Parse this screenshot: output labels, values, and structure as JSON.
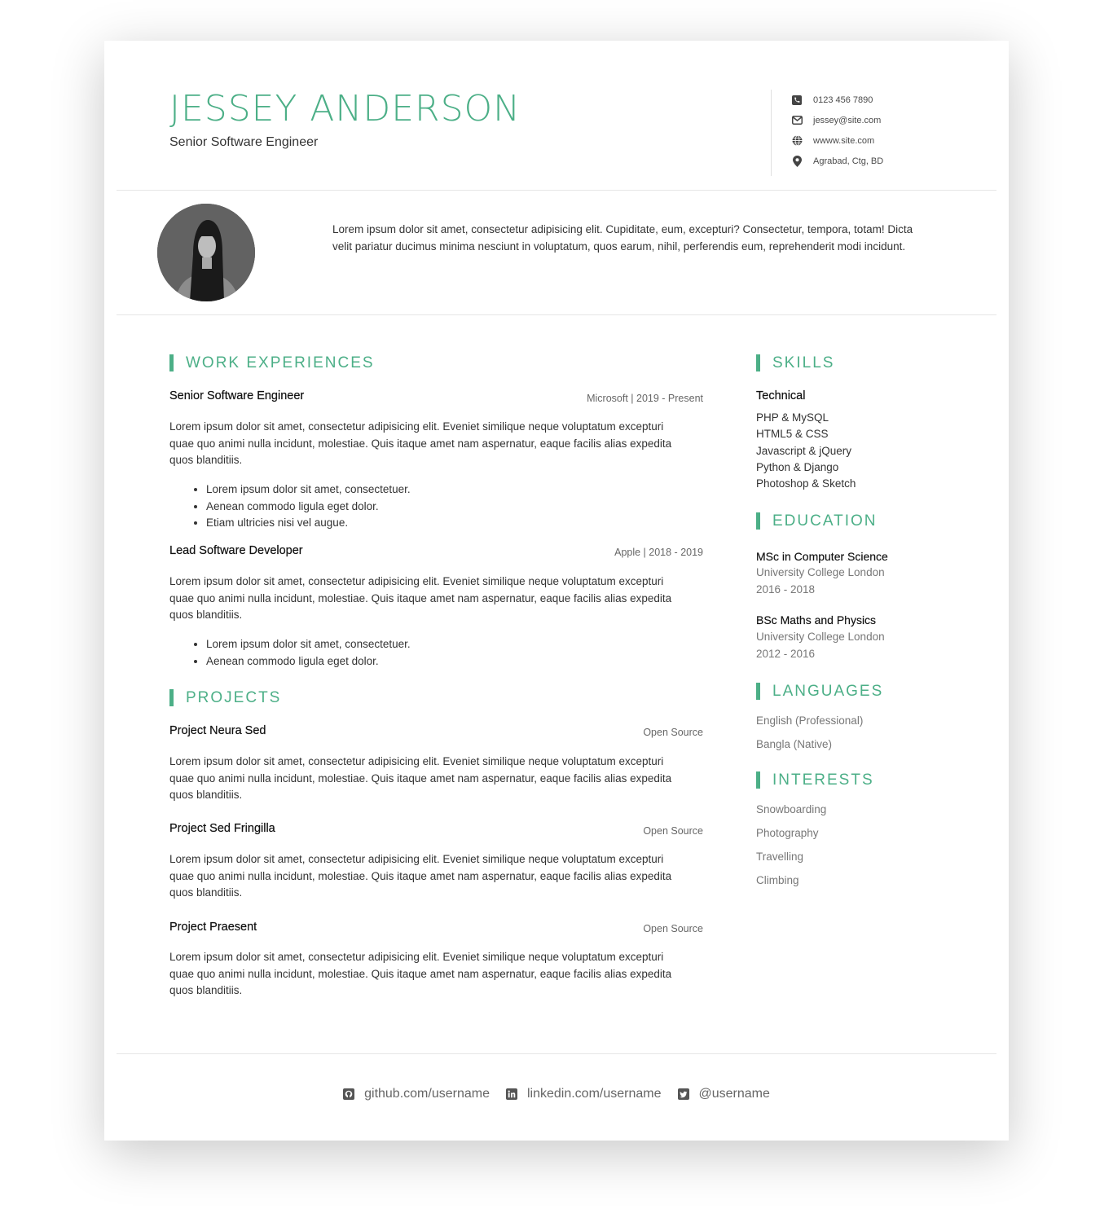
{
  "header": {
    "name": "JESSEY ANDERSON",
    "tagline": "Senior Software Engineer",
    "contact": [
      {
        "icon": "phone-icon",
        "text": "0123 456 7890"
      },
      {
        "icon": "envelope-icon",
        "text": "jessey@site.com"
      },
      {
        "icon": "globe-icon",
        "text": "wwww.site.com"
      },
      {
        "icon": "map-marker-icon",
        "text": "Agrabad, Ctg, BD"
      }
    ]
  },
  "summary": {
    "text": "Lorem ipsum dolor sit amet, consectetur adipisicing elit. Cupiditate, eum, excepturi? Consectetur, tempora, totam! Dicta velit pariatur ducimus minima nesciunt in voluptatum, quos earum, nihil, perferendis eum, reprehenderit modi incidunt."
  },
  "work": {
    "title": "WORK EXPERIENCES",
    "items": [
      {
        "title": "Senior Software Engineer",
        "meta": "Microsoft | 2019 - Present",
        "desc": "Lorem ipsum dolor sit amet, consectetur adipisicing elit. Eveniet similique neque voluptatum excepturi quae quo animi nulla incidunt, molestiae. Quis itaque amet nam aspernatur, eaque facilis alias expedita quos blanditiis.",
        "bullets": [
          "Lorem ipsum dolor sit amet, consectetuer.",
          "Aenean commodo ligula eget dolor.",
          "Etiam ultricies nisi vel augue."
        ]
      },
      {
        "title": "Lead Software Developer",
        "meta": "Apple | 2018 - 2019",
        "desc": "Lorem ipsum dolor sit amet, consectetur adipisicing elit. Eveniet similique neque voluptatum excepturi quae quo animi nulla incidunt, molestiae. Quis itaque amet nam aspernatur, eaque facilis alias expedita quos blanditiis.",
        "bullets": [
          "Lorem ipsum dolor sit amet, consectetuer.",
          "Aenean commodo ligula eget dolor."
        ]
      }
    ]
  },
  "projects": {
    "title": "PROJECTS",
    "items": [
      {
        "title": "Project Neura Sed",
        "meta": "Open Source",
        "desc": "Lorem ipsum dolor sit amet, consectetur adipisicing elit. Eveniet similique neque voluptatum excepturi quae quo animi nulla incidunt, molestiae. Quis itaque amet nam aspernatur, eaque facilis alias expedita quos blanditiis."
      },
      {
        "title": "Project Sed Fringilla",
        "meta": "Open Source",
        "desc": "Lorem ipsum dolor sit amet, consectetur adipisicing elit. Eveniet similique neque voluptatum excepturi quae quo animi nulla incidunt, molestiae. Quis itaque amet nam aspernatur, eaque facilis alias expedita quos blanditiis."
      },
      {
        "title": "Project Praesent",
        "meta": "Open Source",
        "desc": "Lorem ipsum dolor sit amet, consectetur adipisicing elit. Eveniet similique neque voluptatum excepturi quae quo animi nulla incidunt, molestiae. Quis itaque amet nam aspernatur, eaque facilis alias expedita quos blanditiis."
      }
    ]
  },
  "skills": {
    "title": "SKILLS",
    "subtitle": "Technical",
    "items": [
      "PHP & MySQL",
      "HTML5 & CSS",
      "Javascript & jQuery",
      "Python & Django",
      "Photoshop & Sketch"
    ]
  },
  "education": {
    "title": "EDUCATION",
    "items": [
      {
        "degree": "MSc in Computer Science",
        "school": "University College London",
        "years": "2016 - 2018"
      },
      {
        "degree": "BSc Maths and Physics",
        "school": "University College London",
        "years": "2012 - 2016"
      }
    ]
  },
  "languages": {
    "title": "LANGUAGES",
    "items": [
      "English (Professional)",
      "Bangla (Native)"
    ]
  },
  "interests": {
    "title": "INTERESTS",
    "items": [
      "Snowboarding",
      "Photography",
      "Travelling",
      "Climbing"
    ]
  },
  "footer": {
    "links": [
      {
        "icon": "github-icon",
        "text": "github.com/username"
      },
      {
        "icon": "linkedin-icon",
        "text": "linkedin.com/username"
      },
      {
        "icon": "twitter-icon",
        "text": "@username"
      }
    ]
  },
  "colors": {
    "accent": "#4caf87",
    "text": "#333333",
    "muted": "#777777"
  }
}
